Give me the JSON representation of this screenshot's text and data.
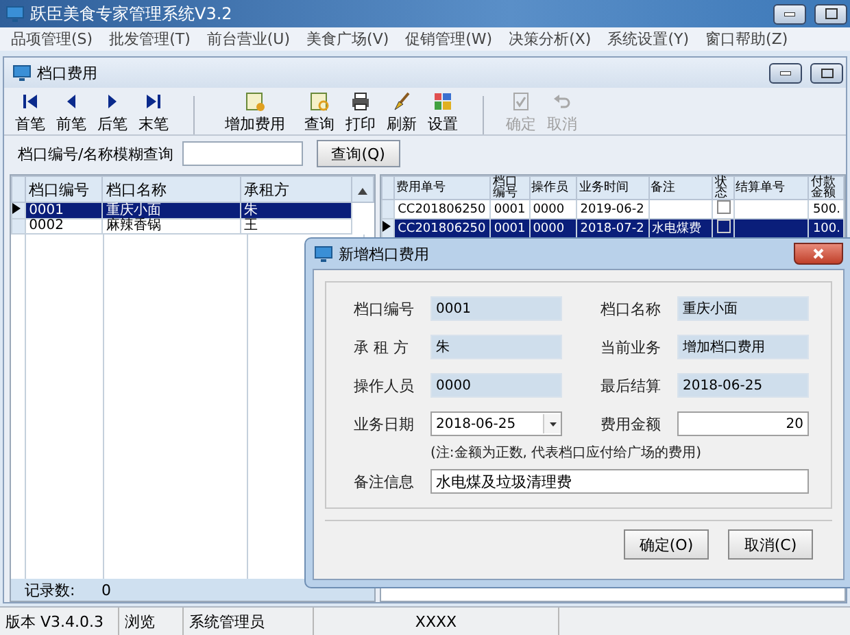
{
  "window": {
    "title": "跃臣美食专家管理系统V3.2"
  },
  "menu": [
    "品项管理(S)",
    "批发管理(T)",
    "前台营业(U)",
    "美食广场(V)",
    "促销管理(W)",
    "决策分析(X)",
    "系统设置(Y)",
    "窗口帮助(Z)"
  ],
  "child_window": {
    "title": "档口费用"
  },
  "toolbar": [
    {
      "label": "首笔",
      "kind": "first",
      "disabled": false
    },
    {
      "label": "前笔",
      "kind": "prev",
      "disabled": false
    },
    {
      "label": "后笔",
      "kind": "next",
      "disabled": false
    },
    {
      "label": "末笔",
      "kind": "last",
      "disabled": false
    },
    {
      "label": "增加费用",
      "kind": "add",
      "disabled": false
    },
    {
      "label": "查询",
      "kind": "query",
      "disabled": false
    },
    {
      "label": "打印",
      "kind": "print",
      "disabled": false
    },
    {
      "label": "刷新",
      "kind": "refresh",
      "disabled": false
    },
    {
      "label": "设置",
      "kind": "settings",
      "disabled": false
    },
    {
      "label": "确定",
      "kind": "confirm",
      "disabled": true
    },
    {
      "label": "取消",
      "kind": "undo",
      "disabled": true
    }
  ],
  "search": {
    "label": "档口编号/名称模糊查询",
    "button": "查询(Q)"
  },
  "stall_table": {
    "columns": [
      "档口编号",
      "档口名称",
      "承租方"
    ],
    "rows": [
      {
        "cells": [
          "0001",
          "重庆小面",
          "朱"
        ],
        "selected": true
      },
      {
        "cells": [
          "0002",
          "麻辣香锅",
          "王"
        ],
        "selected": false
      }
    ],
    "footer": {
      "label": "记录数:",
      "value": "0"
    }
  },
  "fee_table": {
    "columns": [
      "费用单号",
      "档口编号",
      "操作员",
      "业务时间",
      "备注",
      "状态",
      "结算单号",
      "付款金额"
    ],
    "rows": [
      {
        "cells": [
          "CC201806250",
          "0001",
          "0000",
          "2019-06-2",
          "",
          "",
          "500."
        ],
        "checked": false,
        "selected": false
      },
      {
        "cells": [
          "CC201806250",
          "0001",
          "0000",
          "2018-07-2",
          "水电煤费",
          "",
          "100."
        ],
        "checked": false,
        "selected": true
      }
    ]
  },
  "dialog": {
    "title": "新增档口费用",
    "fields": [
      {
        "label": "档口编号",
        "value": "0001",
        "kind": "readonly"
      },
      {
        "label": "档口名称",
        "value": "重庆小面",
        "kind": "readonly"
      },
      {
        "label": "承 租 方",
        "value": "朱",
        "kind": "readonly"
      },
      {
        "label": "当前业务",
        "value": "增加档口费用",
        "kind": "readonly"
      },
      {
        "label": "操作人员",
        "value": "0000",
        "kind": "readonly"
      },
      {
        "label": "最后结算",
        "value": "2018-06-25",
        "kind": "readonly"
      },
      {
        "label": "业务日期",
        "value": "2018-06-25",
        "kind": "date"
      },
      {
        "label": "费用金额",
        "value": "20",
        "kind": "amount"
      }
    ],
    "note": "(注:金额为正数, 代表档口应付给广场的费用)",
    "remark": {
      "label": "备注信息",
      "value": "水电煤及垃圾清理费"
    },
    "buttons": [
      "确定(O)",
      "取消(C)"
    ]
  },
  "status_bar": [
    "版本 V3.4.0.3",
    "浏览",
    "系统管理员",
    "XXXX"
  ]
}
